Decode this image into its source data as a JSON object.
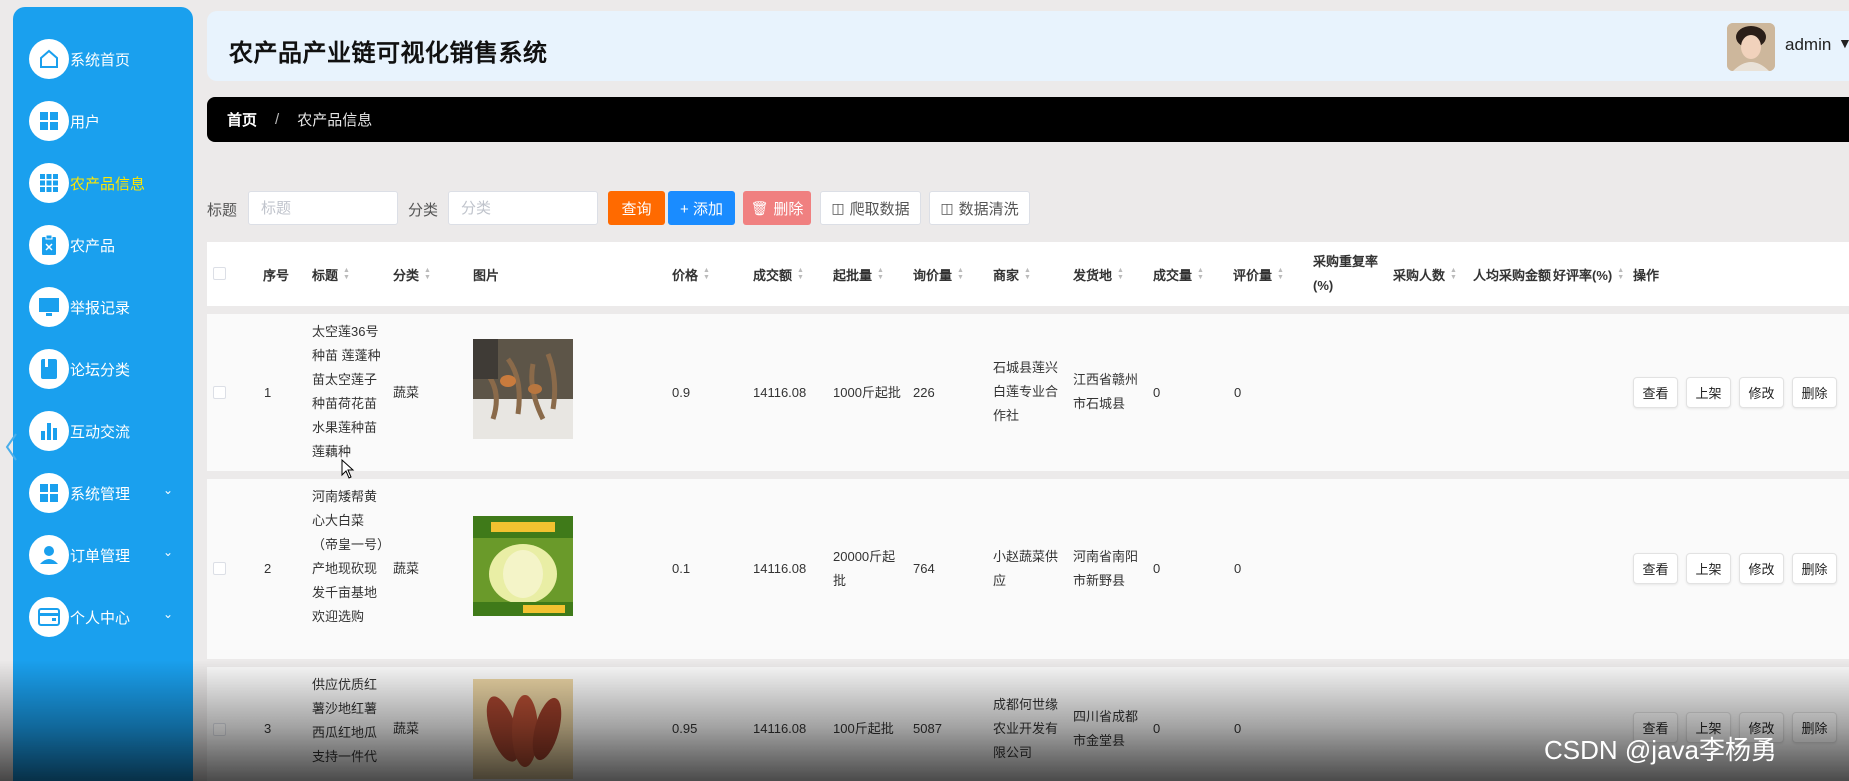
{
  "sidebar": {
    "items": [
      {
        "label": "系统首页",
        "icon": "home-icon",
        "active": false,
        "expandable": false
      },
      {
        "label": "用户",
        "icon": "grid-icon",
        "active": false,
        "expandable": false
      },
      {
        "label": "农产品信息",
        "icon": "apps-icon",
        "active": true,
        "expandable": false
      },
      {
        "label": "农产品",
        "icon": "clipboard-icon",
        "active": false,
        "expandable": false
      },
      {
        "label": "举报记录",
        "icon": "monitor-icon",
        "active": false,
        "expandable": false
      },
      {
        "label": "论坛分类",
        "icon": "book-icon",
        "active": false,
        "expandable": false
      },
      {
        "label": "互动交流",
        "icon": "bar-chart-icon",
        "active": false,
        "expandable": false
      },
      {
        "label": "系统管理",
        "icon": "grid-icon",
        "active": false,
        "expandable": true
      },
      {
        "label": "订单管理",
        "icon": "user-icon",
        "active": false,
        "expandable": true
      },
      {
        "label": "个人中心",
        "icon": "wallet-icon",
        "active": false,
        "expandable": true
      }
    ],
    "colors": {
      "background": "#1aa0ee",
      "active_label": "#ffe600"
    }
  },
  "header": {
    "title": "农产品产业链可视化销售系统",
    "username": "admin"
  },
  "breadcrumb": {
    "home": "首页",
    "separator": "/",
    "current": "农产品信息"
  },
  "search": {
    "title_label": "标题",
    "title_placeholder": "标题",
    "category_label": "分类",
    "category_placeholder": "分类",
    "query_button": "查询",
    "add_button": "+ 添加",
    "delete_button": "删除",
    "crawl_button": "爬取数据",
    "clean_button": "数据清洗"
  },
  "table": {
    "headers": {
      "index": "序号",
      "title": "标题",
      "category": "分类",
      "image": "图片",
      "price": "价格",
      "turnover": "成交额",
      "min_batch": "起批量",
      "inquiry": "询价量",
      "merchant": "商家",
      "origin": "发货地",
      "deals": "成交量",
      "reviews": "评价量",
      "repurchase_rate_line1": "采购重复率",
      "repurchase_rate_line2": "(%)",
      "buyers": "采购人数",
      "avg_amount": "人均采购金额",
      "good_rate": "好评率(%)",
      "actions": "操作"
    },
    "rows": [
      {
        "index": "1",
        "title": "太空莲36号种苗 莲蓬种苗太空莲子种苗荷花苗水果莲种苗莲藕种",
        "category": "蔬菜",
        "price": "0.9",
        "turnover": "14116.08",
        "min_batch": "1000斤起批",
        "inquiry": "226",
        "merchant": "石城县莲兴白莲专业合作社",
        "origin": "江西省赣州市石城县",
        "deals": "0",
        "reviews": "0"
      },
      {
        "index": "2",
        "title": "河南矮帮黄心大白菜（帝皇一号）产地现砍现发千亩基地 欢迎选购",
        "category": "蔬菜",
        "price": "0.1",
        "turnover": "14116.08",
        "min_batch": "20000斤起批",
        "inquiry": "764",
        "merchant": "小赵蔬菜供应",
        "origin": "河南省南阳市新野县",
        "deals": "0",
        "reviews": "0"
      },
      {
        "index": "3",
        "title": "供应优质红薯沙地红薯西瓜红地瓜支持一件代",
        "category": "蔬菜",
        "price": "0.95",
        "turnover": "14116.08",
        "min_batch": "100斤起批",
        "inquiry": "5087",
        "merchant": "成都何世缘农业开发有限公司",
        "origin": "四川省成都市金堂县",
        "deals": "0",
        "reviews": "0"
      }
    ],
    "row_actions": {
      "view": "查看",
      "shelve": "上架",
      "edit": "修改",
      "delete": "删除"
    }
  },
  "overlay": {
    "watermark": "CSDN @java李杨勇"
  }
}
